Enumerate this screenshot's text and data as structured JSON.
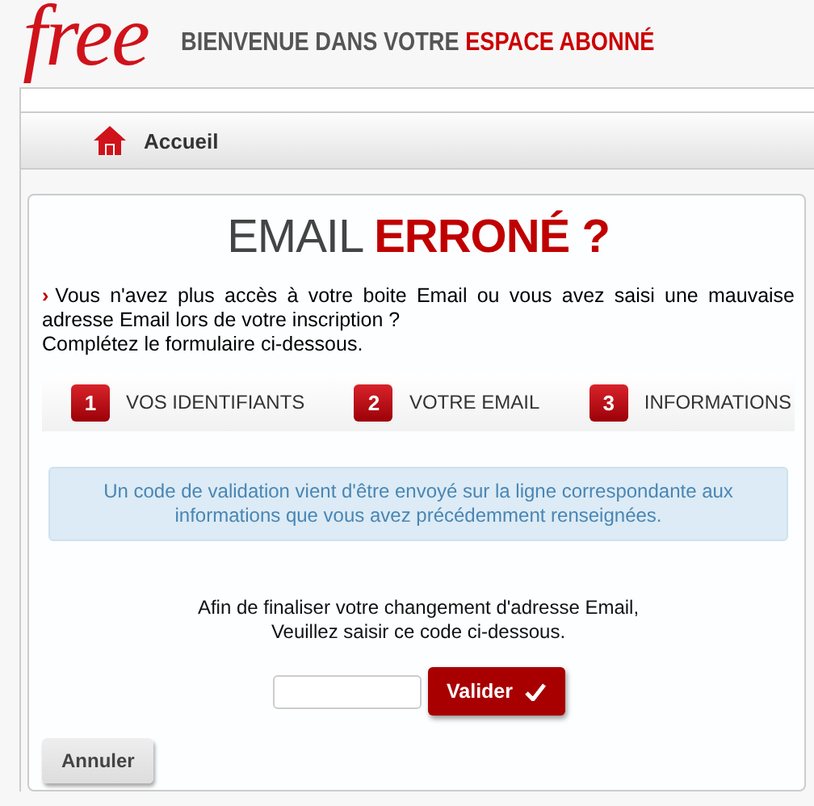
{
  "header": {
    "logo": "free",
    "title": "BIENVENUE DANS VOTRE",
    "title_highlight": "ESPACE ABONNÉ"
  },
  "nav": {
    "items": [
      {
        "label": "Accueil"
      }
    ]
  },
  "card": {
    "title": "EMAIL",
    "title_highlight": "ERRONÉ ?",
    "bullet": "›",
    "intro": "Vous n'avez plus accès à votre boite Email ou vous avez saisi une mauvaise adresse Email lors de votre inscription ?",
    "intro_2": "Complétez le formulaire ci-dessous.",
    "steps": [
      {
        "number": "1",
        "label": "VOS IDENTIFIANTS"
      },
      {
        "number": "2",
        "label": "VOTRE EMAIL"
      },
      {
        "number": "3",
        "label": "INFORMATIONS"
      }
    ],
    "notice": "Un code de validation vient d'être envoyé sur la ligne correspondante aux informations que vous avez précédemment renseignées.",
    "instruction": "Afin de finaliser votre changement d'adresse Email,",
    "instruction_2": "Veuillez saisir ce code ci-dessous.",
    "submit": "Valider",
    "cancel": "Annuler"
  }
}
